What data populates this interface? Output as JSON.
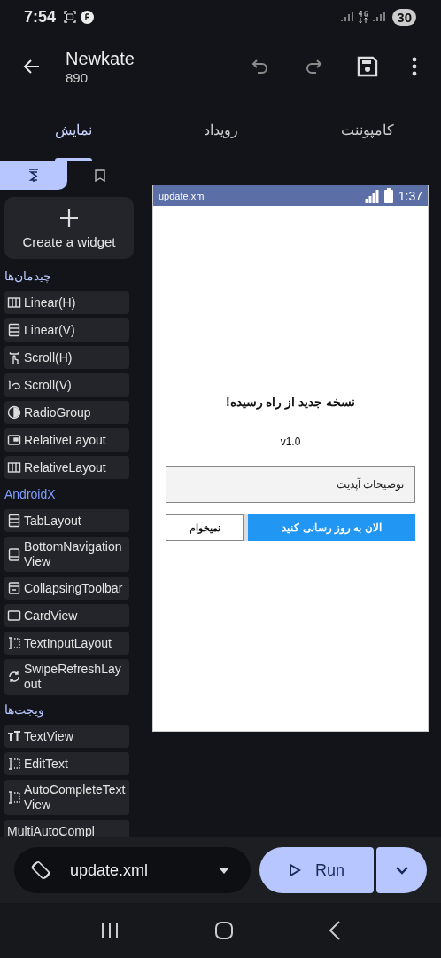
{
  "status_bar": {
    "time": "7:54",
    "battery": "30"
  },
  "app_bar": {
    "title": "Newkate",
    "subtitle": "890"
  },
  "tabs": [
    {
      "label": "کامپوننت",
      "selected": false
    },
    {
      "label": "رویداد",
      "selected": false
    },
    {
      "label": "نمایش",
      "selected": true
    }
  ],
  "side_tabs": [
    {
      "kind": "palette",
      "selected": true
    },
    {
      "kind": "bookmark",
      "selected": false
    }
  ],
  "create_widget": {
    "label": "Create a widget"
  },
  "sections": [
    {
      "title": "چیدمان‌ها",
      "kind": "local",
      "items": [
        {
          "label": "Linear(H)",
          "kind": "columns"
        },
        {
          "label": "Linear(V)",
          "kind": "rows"
        },
        {
          "label": "Scroll(H)",
          "kind": "scroll-h"
        },
        {
          "label": "Scroll(V)",
          "kind": "scroll-v"
        },
        {
          "label": "RadioGroup",
          "kind": "radio"
        },
        {
          "label": "RelativeLayout",
          "kind": "relative"
        },
        {
          "label": "RelativeLayout",
          "kind": "columns"
        }
      ]
    },
    {
      "title": "AndroidX",
      "kind": "androidx",
      "items": [
        {
          "label": "TabLayout",
          "kind": "tabs"
        },
        {
          "label": "BottomNavigationView",
          "kind": "bottom-nav"
        },
        {
          "label": "CollapsingToolbar",
          "kind": "collapsing"
        },
        {
          "label": "CardView",
          "kind": "card"
        },
        {
          "label": "TextInputLayout",
          "kind": "text-input"
        },
        {
          "label": "SwipeRefreshLayout",
          "kind": "refresh"
        }
      ]
    },
    {
      "title": "ویجت‌ها",
      "kind": "local",
      "items": [
        {
          "label": "TextView",
          "kind": "text"
        },
        {
          "label": "EditText",
          "kind": "text-input"
        },
        {
          "label": "AutoCompleteTextView",
          "kind": "text-input"
        },
        {
          "label": "MultiAutoCompl",
          "kind": "none"
        }
      ]
    }
  ],
  "preview": {
    "file": "update.xml",
    "time": "1:37",
    "heading": "نسخه جدید از راه رسیده!",
    "version": "v1.0",
    "description": "توضیحات آپدیت",
    "primary_button": "الان به روز رسانی کنید",
    "secondary_button": "نمیخوام"
  },
  "bottom_bar": {
    "file": "update.xml",
    "run": "Run"
  }
}
